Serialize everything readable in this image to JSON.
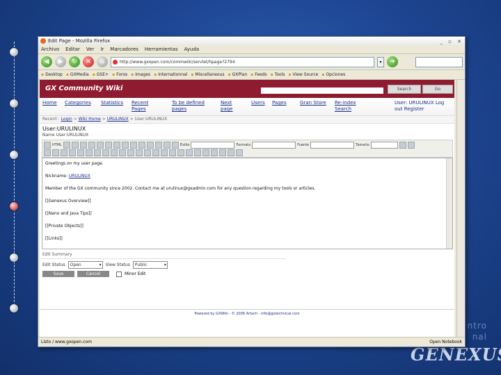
{
  "slide": {
    "brand_text_1": "ntro",
    "brand_text_2": "nal",
    "logo_text": "GENEXUS"
  },
  "browser": {
    "window_title": "Edit Page - Mozilla Firefox",
    "menu": [
      "Archivo",
      "Editar",
      "Ver",
      "Ir",
      "Marcadores",
      "Herramientas",
      "Ayuda"
    ],
    "url": "http://www.gxopen.com/commwiki/servlet/hpage?2794",
    "bookmarks": [
      "Desktop",
      "GXMedia",
      "GSE+",
      "Foros",
      "Images",
      "Internationnal",
      "Miscellaneous",
      "GXPlan",
      "Feeds",
      "Tools",
      "View Source",
      "Opciones"
    ],
    "status_left": "Listo / www.gxopen.com",
    "status_right": "Open Notebook"
  },
  "wiki": {
    "site_title": "GX Community Wiki",
    "search_button": "Search",
    "go_button": "Go",
    "nav": [
      {
        "l1": "Home",
        "l2": ""
      },
      {
        "l1": "Categories",
        "l2": ""
      },
      {
        "l1": "Statistics",
        "l2": ""
      },
      {
        "l1": "Recent",
        "l2": "Pages"
      },
      {
        "l1": "To be defined",
        "l2": "pages"
      },
      {
        "l1": "Next",
        "l2": "page"
      },
      {
        "l1": "Users",
        "l2": ""
      },
      {
        "l1": "Pages",
        "l2": ""
      },
      {
        "l1": "Gran Store",
        "l2": ""
      },
      {
        "l1": "Re-index",
        "l2": "Search"
      }
    ],
    "user_links": {
      "l1": "User: URULINUX Log",
      "l2": "out Register"
    },
    "breadcrumb": [
      "Recent",
      "Login",
      "Wiki Home",
      "URULINUX",
      "User:URULINUX"
    ],
    "page_title": "User:URULINUX",
    "name_label": "Name",
    "name_value": "User:URULINUX",
    "toolbar": {
      "style_label": "Estilo",
      "format_label": "Formato",
      "font_label": "Fuente",
      "size_label": "Tamaño",
      "html_label": "HTML"
    },
    "editor_lines": [
      "Greetings on my user page.",
      "Nickname: URULINUX",
      "Member of the GX community since 2002. Contact me at urulinux@gxadmin.com for any question regarding my tools or articles.",
      "[[Genexus Overview]]",
      "[[Nano and Java Tips]]",
      "[[Private Objects]]",
      "[[Links]]"
    ],
    "edit_summary_label": "Edit Summary",
    "edit_status_label": "Edit Status",
    "edit_status_value": "Open",
    "view_status_label": "View Status",
    "view_status_value": "Public",
    "save_button": "Save",
    "cancel_button": "Cancel",
    "minor_edit_label": "Minor Edit",
    "footer": "Powered by GXWiki - © 2006 Artech - info@gxtechnical.com"
  }
}
